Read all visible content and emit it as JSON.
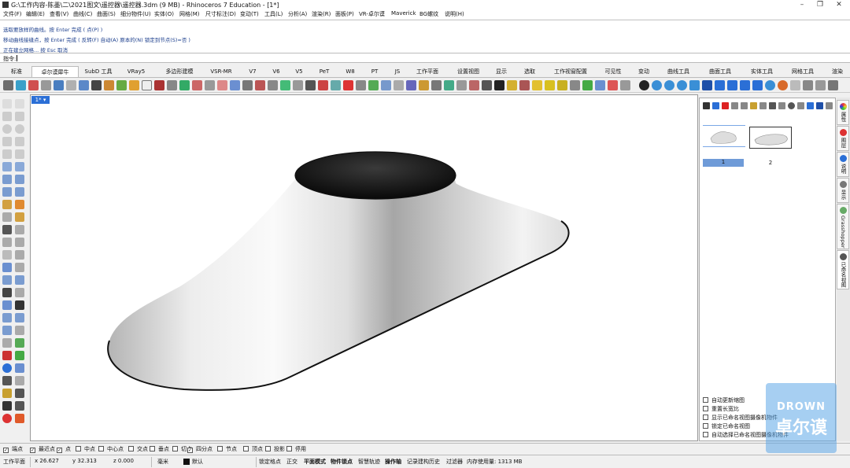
{
  "window": {
    "title": "G:\\工作内容-陈墨\\二\\2021图文\\遥控器\\遥控器.3dm (9 MB) - Rhinoceros 7 Education - [1*]",
    "minimize": "–",
    "maximize": "❐",
    "close": "✕"
  },
  "menu": [
    "文件(F)",
    "编辑(E)",
    "查看(V)",
    "曲线(C)",
    "曲面(S)",
    "细分物件(U)",
    "实体(O)",
    "网格(M)",
    "尺寸标注(D)",
    "变动(T)",
    "工具(L)",
    "分析(A)",
    "渲染(R)",
    "面板(P)",
    "VR-卓尔谟",
    "Maverick",
    "BG螺纹",
    "说明(H)"
  ],
  "command_history": [
    "选取要放样的曲线。按 Enter 完成 ( 点(P) )",
    "移动曲线接缝点，按 Enter 完成 ( 反转(F) 自动(A) 原本的(N) 锁定到节点(S)=否 )",
    "正在建立网格... 按 Esc 取消"
  ],
  "command_prompt": "指令:",
  "tabs": [
    "标准",
    "卓尔谟犀牛",
    "SubD 工具",
    "VRay5",
    "多边形建模",
    "VSR-MR",
    "V7",
    "V6",
    "V5",
    "PeT",
    "W8",
    "PT",
    "JS",
    "工作平面",
    "设置视图",
    "显示",
    "选取",
    "工作视窗配置",
    "可见性",
    "变动",
    "曲线工具",
    "曲面工具",
    "实体工具",
    "网格工具",
    "渲染"
  ],
  "viewport": {
    "tab_label": "1* ▾"
  },
  "panel": {
    "thumbs": [
      {
        "label": "1"
      },
      {
        "label": "2"
      }
    ],
    "options": [
      "自动更新缩图",
      "重置长宽比",
      "显示已命名视图摄像机物件",
      "锁定已命名视图",
      "自动选择已命名视图摄像机物件"
    ]
  },
  "side_tabs": [
    "属性",
    "图层",
    "说明",
    "显示",
    "Grasshopper",
    "已命名视图"
  ],
  "osnaps": [
    {
      "label": "端点",
      "checked": true
    },
    {
      "label": "最近点",
      "checked": true
    },
    {
      "label": "点",
      "checked": true
    },
    {
      "label": "中点",
      "checked": false
    },
    {
      "label": "中心点",
      "checked": false
    },
    {
      "label": "交点",
      "checked": false
    },
    {
      "label": "垂点",
      "checked": false
    },
    {
      "label": "切点",
      "checked": false
    },
    {
      "label": "四分点",
      "checked": true
    },
    {
      "label": "节点",
      "checked": false
    },
    {
      "label": "顶点",
      "checked": false
    },
    {
      "label": "投影",
      "checked": false
    },
    {
      "label": "停用",
      "checked": false
    }
  ],
  "status": {
    "cplane": "工作平面",
    "x": "x 26.627",
    "y": "y 32.313",
    "z": "z 0.000",
    "unit": "毫米",
    "layer": "默认",
    "toggles": [
      "锁定格点",
      "正交",
      "平面模式",
      "物件锁点",
      "智慧轨迹",
      "操作轴",
      "记录建构历史",
      "过滤器"
    ],
    "memory": "内存使用量: 1313 MB"
  },
  "watermark": {
    "line1": "DROWN",
    "line2": "卓尔谟"
  },
  "colors": {
    "accent": "#2b6fd6",
    "selected": "#6f9bd8",
    "surface_light": "#e6e6e6",
    "surface_dark": "#8a8a8a"
  }
}
